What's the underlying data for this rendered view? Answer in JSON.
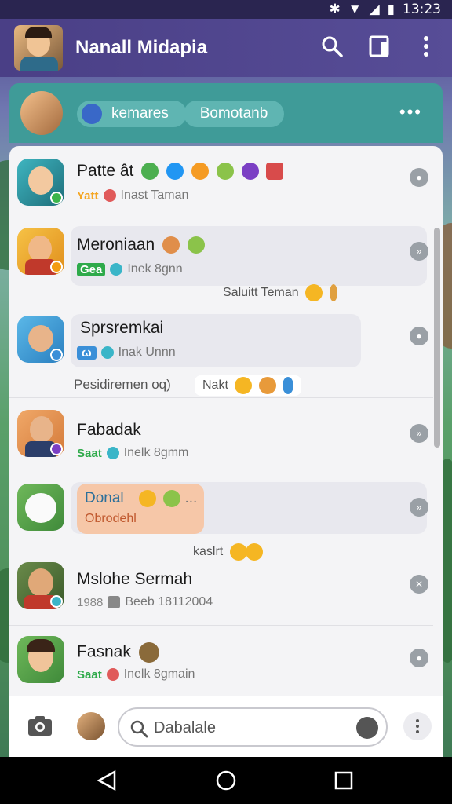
{
  "status": {
    "time": "13:23"
  },
  "appbar": {
    "title": "Nanall Midapia"
  },
  "panel": {
    "chip1": "kemares",
    "chip2": "Bomotanb",
    "more": "•••"
  },
  "chats": [
    {
      "name": "Patte ât",
      "tag": "Yatt",
      "sub": "Inast Taman",
      "tag_color": "#f5a623",
      "dot_color": "#e05a5a"
    },
    {
      "name": "Meroniaan",
      "tag": "Gea",
      "sub": "Inek 8gnn",
      "tag_color": "#2eaa4a",
      "dot_color": "#3ab5c8"
    },
    {
      "name": "Sprsremkai",
      "tag": "ω",
      "sub": "Inak Unnn",
      "tag_color": "#3a8fd8",
      "dot_color": "#3ab5c8"
    },
    {
      "name": "Fabadak",
      "tag": "Saat",
      "sub": "Inelk 8gmm",
      "tag_color": "#2eaa4a",
      "dot_color": "#3ab5c8"
    },
    {
      "name": "Donal",
      "tag": "",
      "sub": "Obrodehl",
      "tag_color": "#e07040",
      "dot_color": "#3ab5c8"
    },
    {
      "name": "Mslohe Sermah",
      "tag": "1988",
      "sub": "Beeb 18112004",
      "tag_color": "#888",
      "dot_color": "#888"
    },
    {
      "name": "Fasnak",
      "tag": "Saat",
      "sub": "Inelk 8gmain",
      "tag_color": "#2eaa4a",
      "dot_color": "#e05a5a"
    }
  ],
  "floating": {
    "f1": "Saluitt Teman",
    "f2": "Pesidiremen oq)",
    "f3": "Nakt",
    "f4": "kaslrt",
    "donal_dots": "..."
  },
  "composer": {
    "placeholder": "Dabalale"
  },
  "icons": [
    "search-icon",
    "tablet-icon",
    "more-vertical-icon",
    "camera-icon",
    "keyboard-icon",
    "back-icon",
    "home-icon",
    "recents-icon"
  ]
}
